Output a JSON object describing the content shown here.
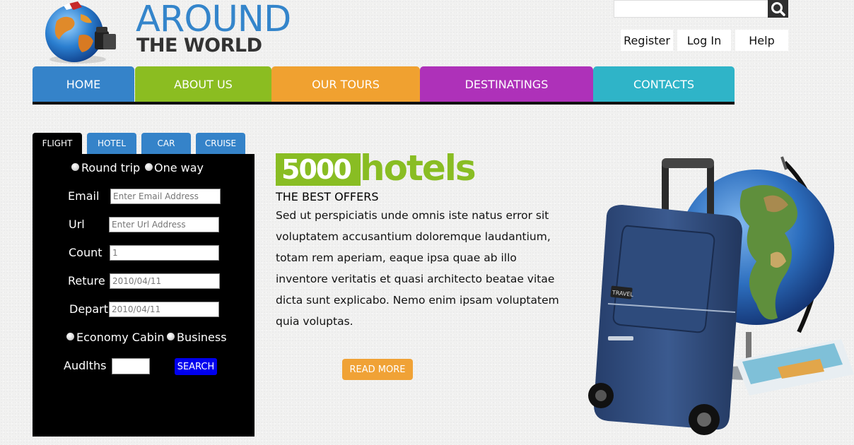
{
  "header": {
    "brand_line1": "AROUND",
    "brand_line2": "THE WORLD",
    "search_placeholder": "",
    "links": [
      "Register",
      "Log In",
      "Help"
    ]
  },
  "nav": {
    "items": [
      {
        "label": "HOME",
        "color": "#3583c9"
      },
      {
        "label": "ABOUT US",
        "color": "#8bbd21"
      },
      {
        "label": "OUR TOURS",
        "color": "#f0a130"
      },
      {
        "label": "DESTINATINGS",
        "color": "#ae31b9"
      },
      {
        "label": "CONTACTS",
        "color": "#2fb4c8"
      }
    ]
  },
  "booking": {
    "tabs": [
      {
        "label": "FLIGHT",
        "color": "#000000"
      },
      {
        "label": "HOTEL",
        "color": "#3583c9"
      },
      {
        "label": "CAR",
        "color": "#3583c9"
      },
      {
        "label": "CRUISE",
        "color": "#3583c9"
      }
    ],
    "trip_options": [
      "Round trip",
      "One way"
    ],
    "email_label": "Email",
    "email_placeholder": "Enter Email Address",
    "url_label": "Url",
    "url_placeholder": "Enter Url Address",
    "count_label": "Count",
    "count_value": "1",
    "return_label": "Reture",
    "return_value": "2010/04/11",
    "depart_label": "Depart",
    "depart_value": "2010/04/11",
    "cabin_options": [
      "Economy Cabin",
      "Business"
    ],
    "adults_label": "Audlths",
    "adults_value": "",
    "search_label": "SEARCH"
  },
  "promo": {
    "number": "5000",
    "word": "hotels",
    "subtitle": "THE BEST OFFERS",
    "body": "Sed ut perspiciatis unde omnis iste natus error sit voluptatem accusantium doloremque laudantium, totam rem aperiam, eaque ipsa quae ab illo inventore veritatis et quasi architecto beatae vitae dicta sunt explicabo. Nemo enim ipsam voluptatem quia voluptas.",
    "button_label": "READ MORE",
    "hero_image": "suitcase-and-globe",
    "suitcase_tag": "TRAVEL"
  },
  "icons": {
    "logo": "globe-logo-icon",
    "search": "search-icon"
  }
}
